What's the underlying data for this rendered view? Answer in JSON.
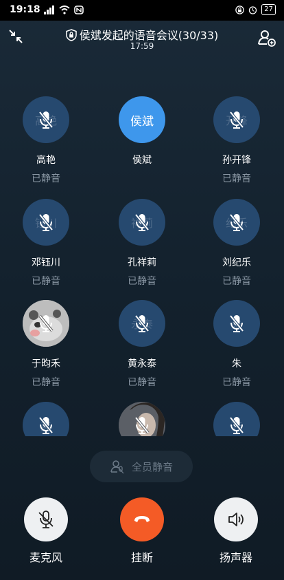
{
  "status_bar": {
    "time": "19:18",
    "battery": "27"
  },
  "header": {
    "title": "侯斌发起的语音会议(30/33)",
    "timer": "17:59"
  },
  "participants": [
    {
      "ghost": "高艳",
      "name": "高艳",
      "status": "已静音"
    },
    {
      "ghost": "侯斌",
      "name": "侯斌",
      "status": ""
    },
    {
      "ghost": "开锋",
      "name": "孙开锋",
      "status": "已静音"
    },
    {
      "ghost": "钰川",
      "name": "邓钰川",
      "status": "已静音"
    },
    {
      "ghost": "祥莉",
      "name": "孔祥莉",
      "status": "已静音"
    },
    {
      "ghost": "纪乐",
      "name": "刘纪乐",
      "status": "已静音"
    },
    {
      "ghost": "",
      "name": "于昀禾",
      "status": "已静音"
    },
    {
      "ghost": "永泰",
      "name": "黄永泰",
      "status": "已静音"
    },
    {
      "ghost": "朱",
      "name": "朱",
      "status": "已静音"
    },
    {
      "ghost": "美",
      "name": "",
      "status": ""
    },
    {
      "ghost": "",
      "name": "",
      "status": ""
    },
    {
      "ghost": "志",
      "name": "",
      "status": ""
    }
  ],
  "mute_all_label": "全员静音",
  "controls": {
    "mic": "麦克风",
    "hangup": "挂断",
    "speaker": "扬声器"
  }
}
